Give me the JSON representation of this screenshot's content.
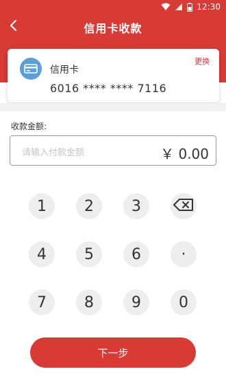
{
  "status_bar": {
    "time": "12:30"
  },
  "nav": {
    "title": "信用卡收款"
  },
  "card": {
    "type": "信用卡",
    "number": "6016 **** **** 7116",
    "change": "更换"
  },
  "amount": {
    "label": "收款金额:",
    "placeholder": "请输入付款金额",
    "value": "￥ 0.00"
  },
  "keypad": {
    "k1": "1",
    "k2": "2",
    "k3": "3",
    "k4": "4",
    "k5": "5",
    "k6": "6",
    "dot": "·",
    "k7": "7",
    "k8": "8",
    "k9": "9",
    "k0": "0"
  },
  "next_button": "下一步",
  "colors": {
    "brand": "#d83a36",
    "card_icon": "#5c9ed6",
    "key_bg": "#eeeeee"
  }
}
